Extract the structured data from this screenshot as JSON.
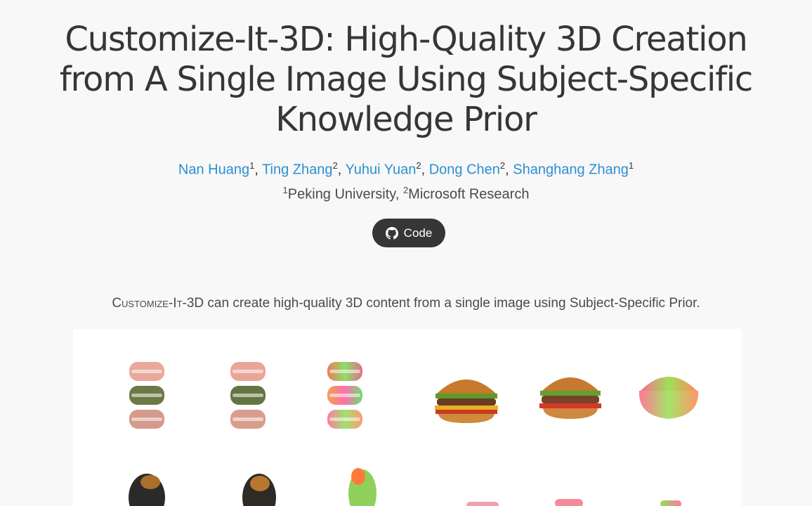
{
  "paper": {
    "title_lines": [
      "Customize-It-3D: High-Quality 3D Creation",
      "from A Single Image Using Subject-Specific",
      "Knowledge Prior"
    ],
    "authors": [
      {
        "name": "Nan Huang",
        "aff": "1"
      },
      {
        "name": "Ting Zhang",
        "aff": "2"
      },
      {
        "name": "Yuhui Yuan",
        "aff": "2"
      },
      {
        "name": "Dong Chen",
        "aff": "2"
      },
      {
        "name": "Shanghang Zhang",
        "aff": "1"
      }
    ],
    "affiliations": [
      {
        "num": "1",
        "name": "Peking University"
      },
      {
        "num": "2",
        "name": "Microsoft Research"
      }
    ],
    "code_button": {
      "label": "Code",
      "icon": "github-icon"
    },
    "tagline": {
      "method": "Customize-It-3D",
      "text": "can create high-quality 3D content from a single image using Subject-Specific Prior."
    }
  },
  "colors": {
    "link": "#2a8fd3",
    "button_bg": "#363636",
    "title": "#363636",
    "background": "#f8f8f8"
  }
}
